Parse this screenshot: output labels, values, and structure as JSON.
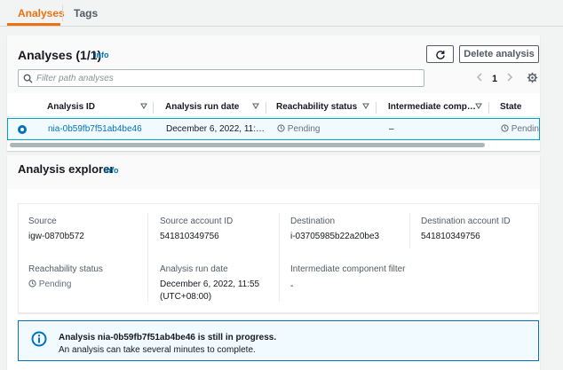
{
  "tabs": [
    {
      "label": "Analyses",
      "active": true
    },
    {
      "label": "Tags",
      "active": false
    }
  ],
  "analyses": {
    "title": "Analyses",
    "count": "(1/1)",
    "info": "Info",
    "refresh_icon": "refresh-icon",
    "delete_label": "Delete analysis",
    "search_placeholder": "Filter path analyses",
    "pagination": {
      "page": "1"
    },
    "columns": [
      "Analysis ID",
      "Analysis run date",
      "Reachability status",
      "Intermediate comp…",
      "State"
    ],
    "rows": [
      {
        "selected": true,
        "analysis_id": "nia-0b59fb7f51ab4be46",
        "run_date": "December 6, 2022, 11:…",
        "reachability": "Pending",
        "intermediate": "–",
        "state": "Pending"
      }
    ]
  },
  "explorer": {
    "title": "Analysis explorer",
    "info": "Info",
    "fields": {
      "source_label": "Source",
      "source_value": "igw-0870b572",
      "source_account_label": "Source account ID",
      "source_account_value": "541810349756",
      "destination_label": "Destination",
      "destination_value": "i-03705985b22a20be3",
      "destination_account_label": "Destination account ID",
      "destination_account_value": "541810349756",
      "reachability_label": "Reachability status",
      "reachability_value": "Pending",
      "run_date_label": "Analysis run date",
      "run_date_line1": "December 6, 2022, 11:55",
      "run_date_line2": "(UTC+08:00)",
      "filter_label": "Intermediate component filter",
      "filter_value": "-"
    },
    "alert": {
      "title": "Analysis nia-0b59fb7f51ab4be46 is still in progress.",
      "body": "An analysis can take several minutes to complete."
    }
  },
  "colors": {
    "accent": "#ec7211",
    "link": "#0073bb",
    "selected_row": "#f1faff"
  }
}
